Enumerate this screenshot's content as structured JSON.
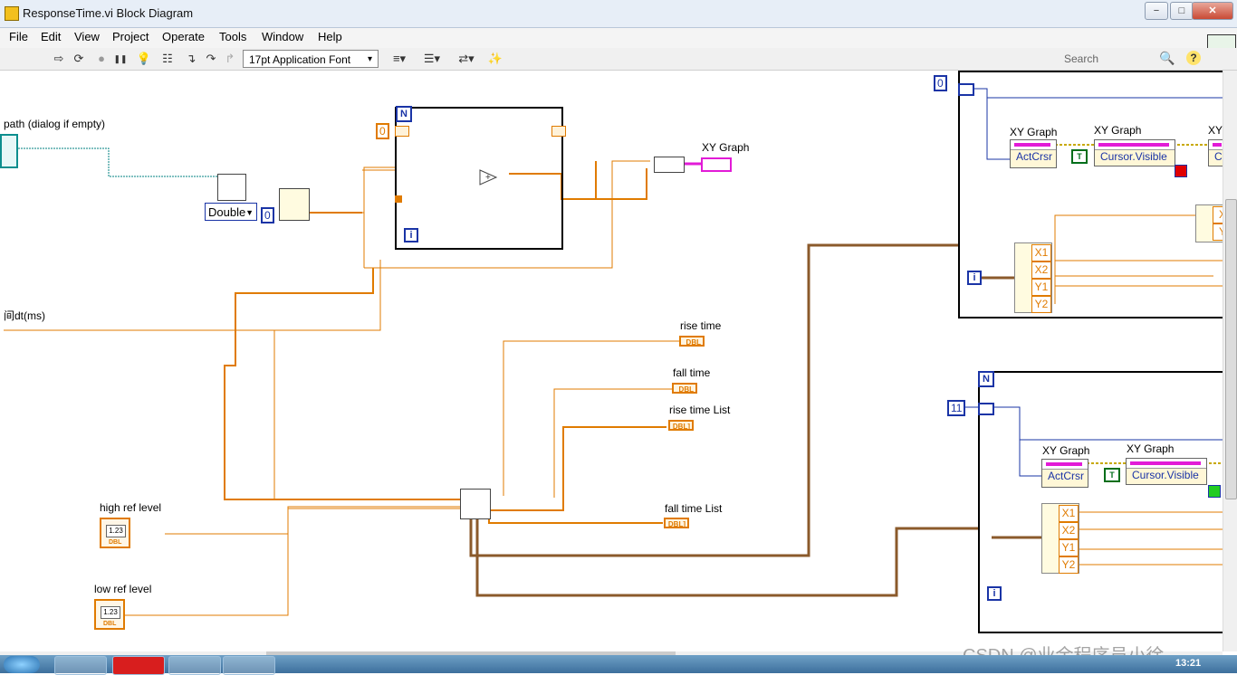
{
  "window": {
    "title": "ResponseTime.vi Block Diagram",
    "min": "−",
    "max": "□",
    "close": "✕"
  },
  "menu": [
    "File",
    "Edit",
    "View",
    "Project",
    "Operate",
    "Tools",
    "Window",
    "Help"
  ],
  "toolbar": {
    "run_icon": "⇨",
    "run_cont_icon": "⟳",
    "abort_icon": "●",
    "pause_icon": "❚❚",
    "highlight_icon": "💡",
    "retain_icon": "☷",
    "step_into_icon": "↴",
    "step_over_icon": "↷",
    "step_out_icon": "↱",
    "font": "17pt Application Font",
    "font_arrow": "▾",
    "align_icon": "≡▾",
    "distribute_icon": "☰▾",
    "reorder_icon": "⇄▾",
    "cleanup_icon": "✨",
    "search_placeholder": "Search",
    "search_icon": "🔍",
    "help_icon": "?"
  },
  "diagram": {
    "path_label": "path (dialog if empty)",
    "dt_label": "间dt(ms)",
    "double_dropdown": "Double",
    "const_zero_a": "0",
    "const_zero_b": "0",
    "shift_init": "0",
    "n_term": "N",
    "i_term": "i",
    "xy_graph_label": "XY Graph",
    "rise_time": "rise time",
    "fall_time": "fall time",
    "rise_time_list": "rise time List",
    "fall_time_list": "fall time List",
    "high_ref_level": "high ref level",
    "low_ref_level": "low ref level",
    "dbl_text": "DBL",
    "dbl_array_text": "DBL]",
    "num_ctl_value": "1.23",
    "upper_loop": {
      "count": "0",
      "graph_label_1": "XY Graph",
      "graph_label_2": "XY Graph",
      "graph_label_3": "XY",
      "prop_1": "ActCrsr",
      "prop_2": "Cursor.Visible",
      "prop_3": "Cu",
      "bool": "T",
      "cluster": [
        "X1",
        "X2",
        "Y1",
        "Y2"
      ],
      "cluster_right": [
        "X",
        "Y"
      ]
    },
    "lower_loop": {
      "count": "11",
      "graph_label_1": "XY Graph",
      "graph_label_2": "XY Graph",
      "prop_1": "ActCrsr",
      "prop_2": "Cursor.Visible",
      "bool": "T",
      "cluster": [
        "X1",
        "X2",
        "Y1",
        "Y2"
      ]
    }
  },
  "taskbar": {
    "clock": "13:21"
  },
  "watermark": "CSDN @业余程序员小徐",
  "colors": {
    "orange_wire": "#e07b00",
    "blue_const": "#1a34a6",
    "pink_graph": "#e21bd7",
    "green_bool": "#006e1a"
  }
}
